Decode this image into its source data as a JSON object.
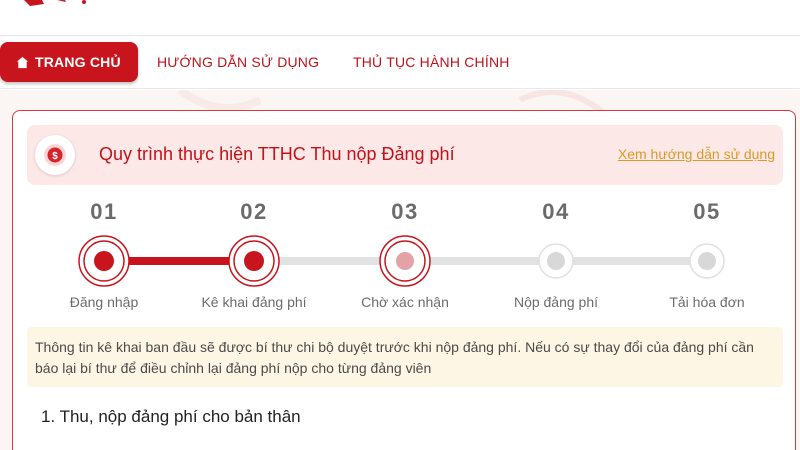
{
  "colors": {
    "brand_red": "#c8141c",
    "title_red": "#c0121a",
    "link_gold": "#d99a28",
    "step_done": "#c8141c",
    "step_pending": "#e3a3a6",
    "step_inactive": "#d8d8d8"
  },
  "nav": {
    "items": [
      {
        "label": "TRANG CHỦ",
        "icon": "home-icon",
        "active": true
      },
      {
        "label": "HƯỚNG DẪN SỬ DỤNG",
        "active": false
      },
      {
        "label": "THỦ TỤC HÀNH CHÍNH",
        "active": false
      }
    ]
  },
  "card": {
    "title": "Quy trình thực hiện TTHC Thu nộp Đảng phí",
    "title_icon": "coin-icon",
    "guide_link": "Xem hướng dẫn sử dụng",
    "steps": [
      {
        "number": "01",
        "label": "Đăng nhập",
        "state": "done"
      },
      {
        "number": "02",
        "label": "Kê khai đảng phí",
        "state": "current"
      },
      {
        "number": "03",
        "label": "Chờ xác nhận",
        "state": "pending"
      },
      {
        "number": "04",
        "label": "Nộp đảng phí",
        "state": "inactive"
      },
      {
        "number": "05",
        "label": "Tải hóa đơn",
        "state": "inactive"
      }
    ],
    "notice": "Thông tin kê khai ban đầu sẽ được bí thư chi bộ duyệt trước khi nộp đảng phí. Nếu có sự thay đổi của đảng phí cần báo lại bí thư để điều chỉnh lại đảng phí nộp cho từng đảng viên",
    "section_title": "1. Thu, nộp đảng phí cho bản thân"
  }
}
